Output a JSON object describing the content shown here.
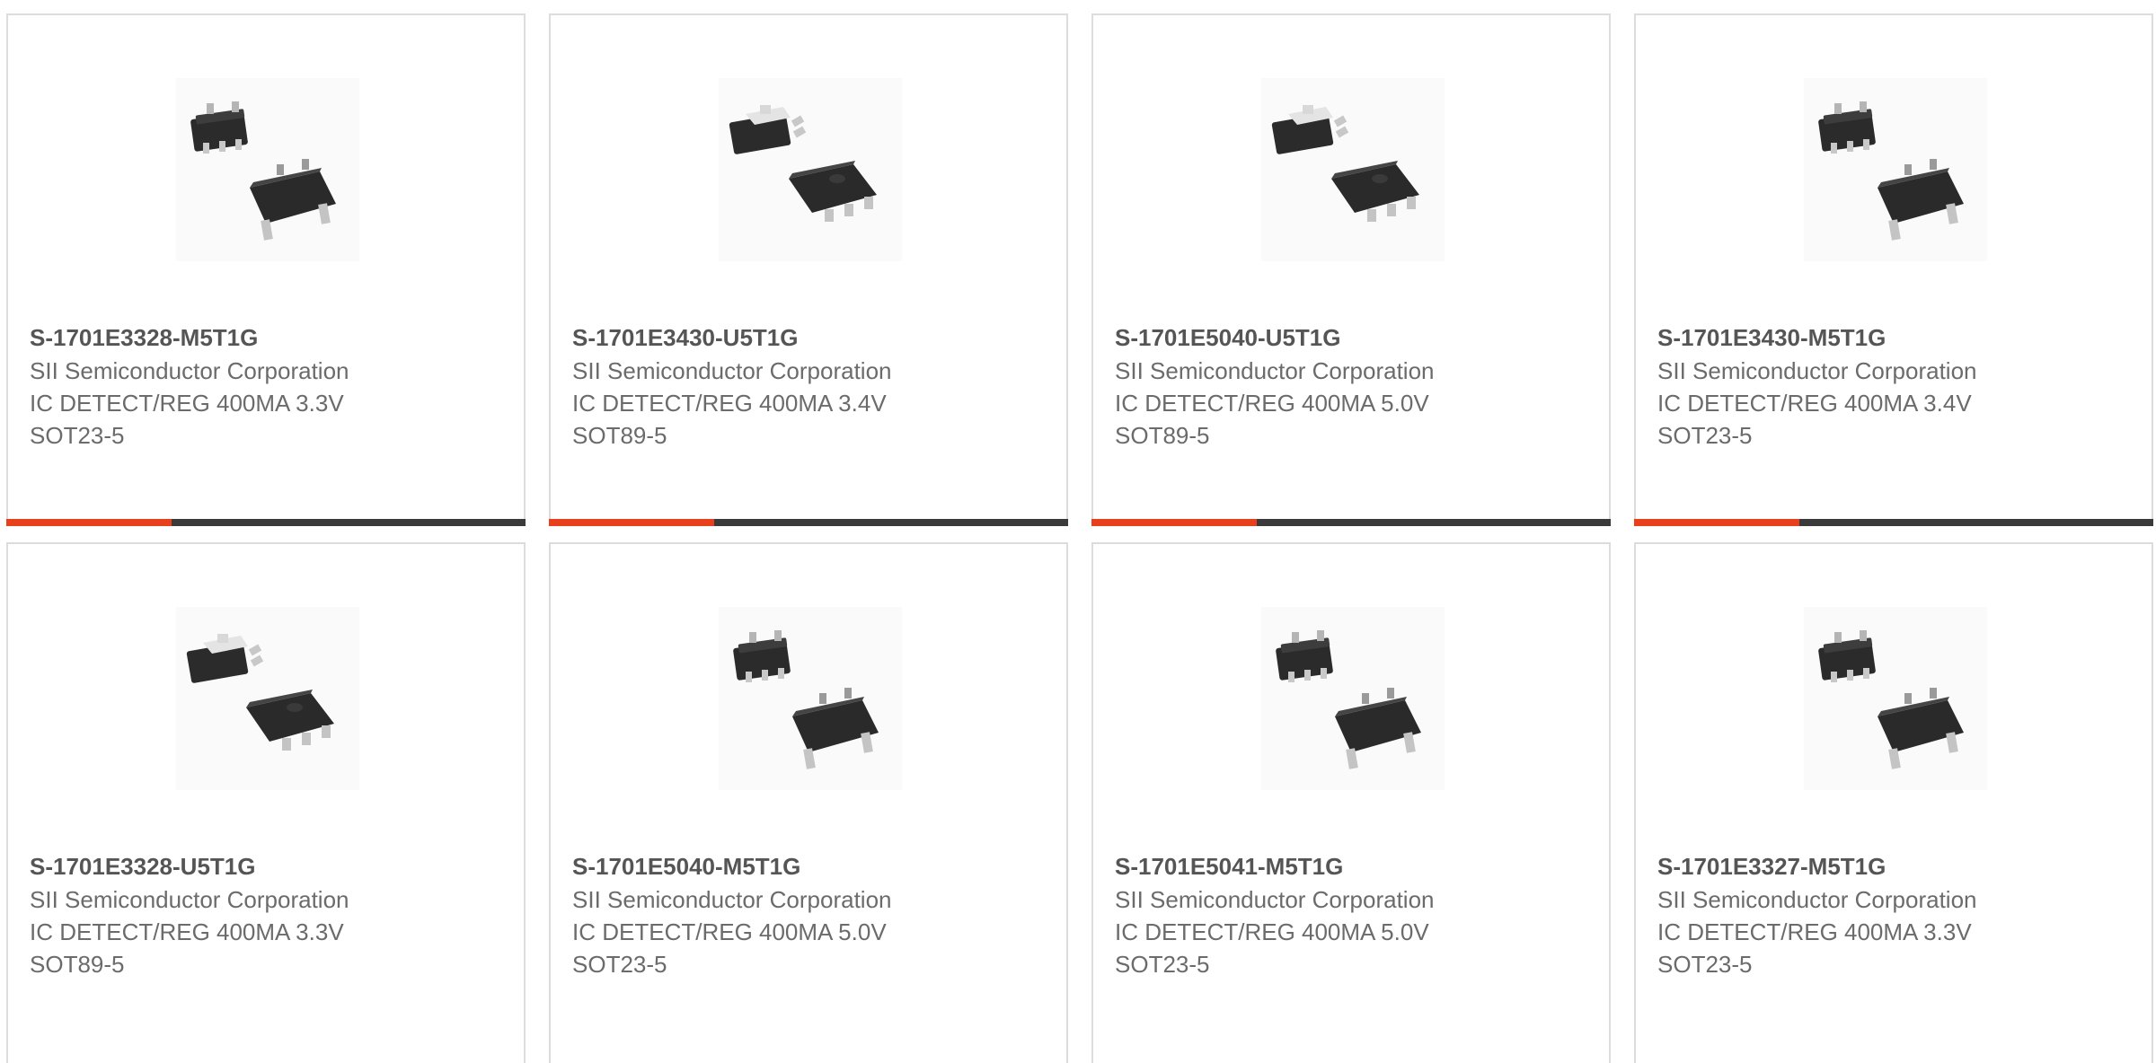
{
  "products": [
    {
      "part": "S-1701E3328-M5T1G",
      "manufacturer": "SII Semiconductor Corporation",
      "description": "IC DETECT/REG 400MA 3.3V",
      "package": "SOT23-5",
      "image_icon": "sot23-5-package-icon"
    },
    {
      "part": "S-1701E3430-U5T1G",
      "manufacturer": "SII Semiconductor Corporation",
      "description": "IC DETECT/REG 400MA 3.4V",
      "package": "SOT89-5",
      "image_icon": "sot89-5-package-icon"
    },
    {
      "part": "S-1701E5040-U5T1G",
      "manufacturer": "SII Semiconductor Corporation",
      "description": "IC DETECT/REG 400MA 5.0V",
      "package": "SOT89-5",
      "image_icon": "sot89-5-package-icon"
    },
    {
      "part": "S-1701E3430-M5T1G",
      "manufacturer": "SII Semiconductor Corporation",
      "description": "IC DETECT/REG 400MA 3.4V",
      "package": "SOT23-5",
      "image_icon": "sot23-5-package-icon"
    },
    {
      "part": "S-1701E3328-U5T1G",
      "manufacturer": "SII Semiconductor Corporation",
      "description": "IC DETECT/REG 400MA 3.3V",
      "package": "SOT89-5",
      "image_icon": "sot89-5-package-icon"
    },
    {
      "part": "S-1701E5040-M5T1G",
      "manufacturer": "SII Semiconductor Corporation",
      "description": "IC DETECT/REG 400MA 5.0V",
      "package": "SOT23-5",
      "image_icon": "sot23-5-package-icon"
    },
    {
      "part": "S-1701E5041-M5T1G",
      "manufacturer": "SII Semiconductor Corporation",
      "description": "IC DETECT/REG 400MA 5.0V",
      "package": "SOT23-5",
      "image_icon": "sot23-5-package-icon"
    },
    {
      "part": "S-1701E3327-M5T1G",
      "manufacturer": "SII Semiconductor Corporation",
      "description": "IC DETECT/REG 400MA 3.3V",
      "package": "SOT23-5",
      "image_icon": "sot23-5-package-icon"
    }
  ],
  "colors": {
    "accent": "#e8401c",
    "bar": "#3a3a3a",
    "border": "#dcdcdc",
    "part_text": "#555555",
    "body_text": "#6b6b6b"
  }
}
